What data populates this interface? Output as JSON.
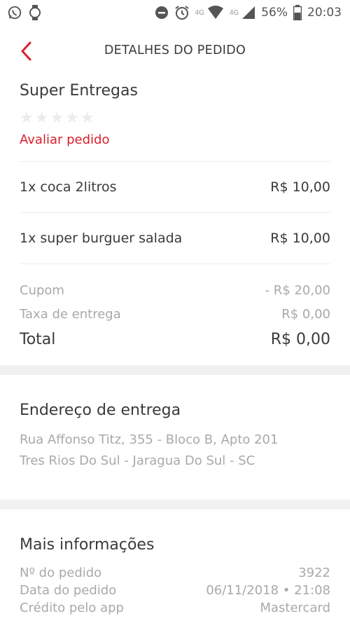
{
  "status_bar": {
    "left_icons": [
      "whatsapp-icon",
      "watch-icon"
    ],
    "net_label_1": "4G",
    "net_label_2": "4G",
    "battery": "56%",
    "time": "20:03"
  },
  "header": {
    "title": "DETALHES DO PEDIDO",
    "accent_color": "#d7212b"
  },
  "store": {
    "name": "Super Entregas",
    "stars": [
      "★",
      "★",
      "★",
      "★",
      "★"
    ],
    "rate_label": "Avaliar pedido"
  },
  "items": [
    {
      "name": "1x coca 2litros",
      "price": "R$ 10,00"
    },
    {
      "name": "1x super burguer salada",
      "price": "R$ 10,00"
    }
  ],
  "summary": {
    "coupon_label": "Cupom",
    "coupon_value": "- R$ 20,00",
    "delivery_label": "Taxa de entrega",
    "delivery_value": "R$ 0,00",
    "total_label": "Total",
    "total_value": "R$ 0,00"
  },
  "delivery_address": {
    "title": "Endereço de entrega",
    "line1": "Rua Affonso Titz, 355 - Bloco B, Apto 201",
    "line2": "Tres Rios Do Sul - Jaragua Do Sul - SC"
  },
  "more_info": {
    "title": "Mais informações",
    "rows": [
      {
        "label": "Nº do pedido",
        "value": "3922"
      },
      {
        "label": "Data do pedido",
        "value": "06/11/2018 • 21:08"
      },
      {
        "label": "Crédito pelo app",
        "value": "Mastercard"
      }
    ]
  }
}
